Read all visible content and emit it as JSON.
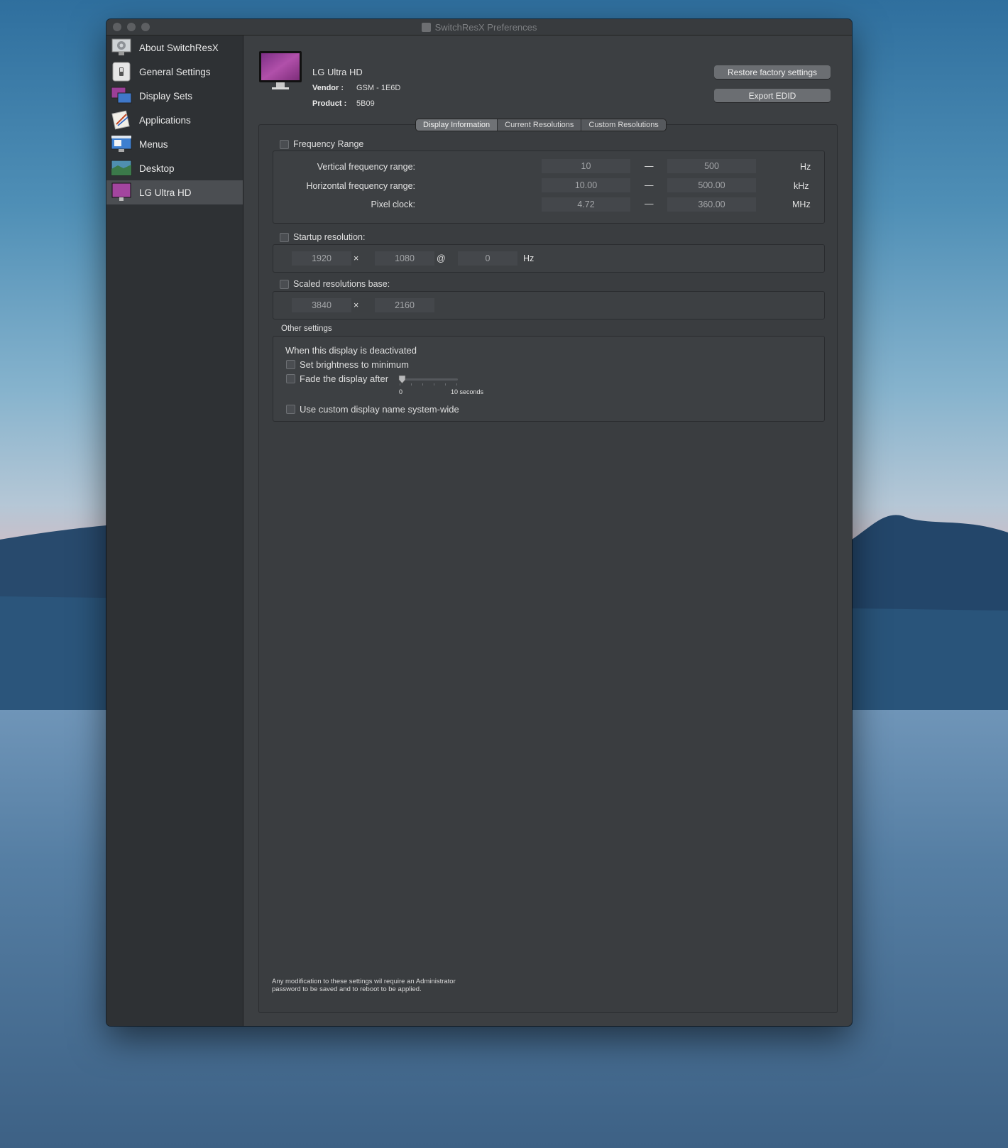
{
  "window": {
    "title": "SwitchResX Preferences"
  },
  "sidebar": {
    "items": [
      {
        "label": "About SwitchResX",
        "icon": "gear-display-icon"
      },
      {
        "label": "General Settings",
        "icon": "switch-icon"
      },
      {
        "label": "Display Sets",
        "icon": "display-sets-icon"
      },
      {
        "label": "Applications",
        "icon": "applications-icon"
      },
      {
        "label": "Menus",
        "icon": "menus-icon"
      },
      {
        "label": "Desktop",
        "icon": "desktop-icon"
      },
      {
        "label": "LG Ultra HD",
        "icon": "monitor-icon",
        "selected": true
      }
    ]
  },
  "header": {
    "display_name": "LG Ultra HD",
    "vendor_label": "Vendor :",
    "vendor_value": "GSM - 1E6D",
    "product_label": "Product :",
    "product_value": "5B09",
    "restore_button": "Restore factory settings",
    "export_button": "Export EDID"
  },
  "tabs": [
    {
      "label": "Display Information",
      "active": true
    },
    {
      "label": "Current Resolutions",
      "active": false
    },
    {
      "label": "Custom Resolutions",
      "active": false
    }
  ],
  "frequency": {
    "checkbox_label": "Frequency Range",
    "rows": [
      {
        "label": "Vertical frequency range:",
        "min": "10",
        "max": "500",
        "unit": "Hz"
      },
      {
        "label": "Horizontal frequency range:",
        "min": "10.00",
        "max": "500.00",
        "unit": "kHz"
      },
      {
        "label": "Pixel clock:",
        "min": "4.72",
        "max": "360.00",
        "unit": "MHz"
      }
    ],
    "separator": "—"
  },
  "startup": {
    "checkbox_label": "Startup resolution:",
    "width": "1920",
    "height": "1080",
    "refresh": "0",
    "times": "×",
    "at": "@",
    "unit": "Hz"
  },
  "scaled": {
    "checkbox_label": "Scaled resolutions base:",
    "width": "3840",
    "height": "2160",
    "times": "×"
  },
  "other": {
    "title": "Other settings",
    "deactivated_label": "When this display is deactivated",
    "brightness_label": "Set brightness to minimum",
    "fade_label": "Fade the display after",
    "slider_min": "0",
    "slider_max": "10 seconds",
    "slider_value": 0,
    "custom_name_label": "Use custom display name system-wide"
  },
  "footnote": {
    "line1": "Any modification to these settings wil require an Administrator",
    "line2": "password to be saved and to reboot to be applied."
  },
  "colors": {
    "window_bg": "#3c3f42",
    "sidebar_bg": "#2e3134",
    "selected_bg": "#4b4e52",
    "monitor_purple": "#a3459f"
  }
}
